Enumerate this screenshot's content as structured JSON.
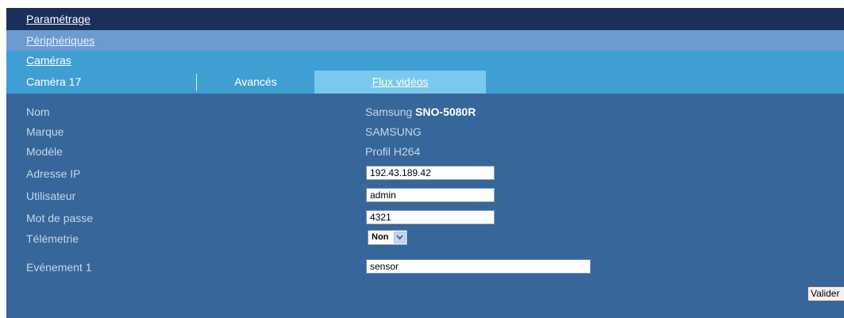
{
  "nav": {
    "parametrage": "Paramétrage",
    "peripheriques": "Périphériques",
    "cameras": "Caméras"
  },
  "tabs": [
    {
      "label": "Caméra 17"
    },
    {
      "label": "Avancés"
    },
    {
      "label": "Flux vidéos"
    }
  ],
  "form": {
    "nom": {
      "label": "Nom",
      "brand": "Samsung",
      "model": "SNO-5080R"
    },
    "marque": {
      "label": "Marque",
      "value": "SAMSUNG"
    },
    "modele": {
      "label": "Modèle",
      "value": "Profil H264"
    },
    "adresse_ip": {
      "label": "Adresse IP",
      "value": "192.43.189.42"
    },
    "utilisateur": {
      "label": "Utilisateur",
      "value": "admin"
    },
    "mot_de_passe": {
      "label": "Mot de passe",
      "value": "4321"
    },
    "telemetrie": {
      "label": "Télémetrie",
      "selected": "Non"
    },
    "evenement1": {
      "label": "Evénement 1",
      "value": "sensor"
    }
  },
  "actions": {
    "valider": "Valider"
  },
  "colors": {
    "nav_dark": "#1a2f5a",
    "nav_mid": "#6b9bd0",
    "nav_light": "#3f9fd2",
    "tab_active": "#79c8ee",
    "panel": "#36669a"
  },
  "icons": {
    "select_arrow": "chevron-down-icon"
  }
}
